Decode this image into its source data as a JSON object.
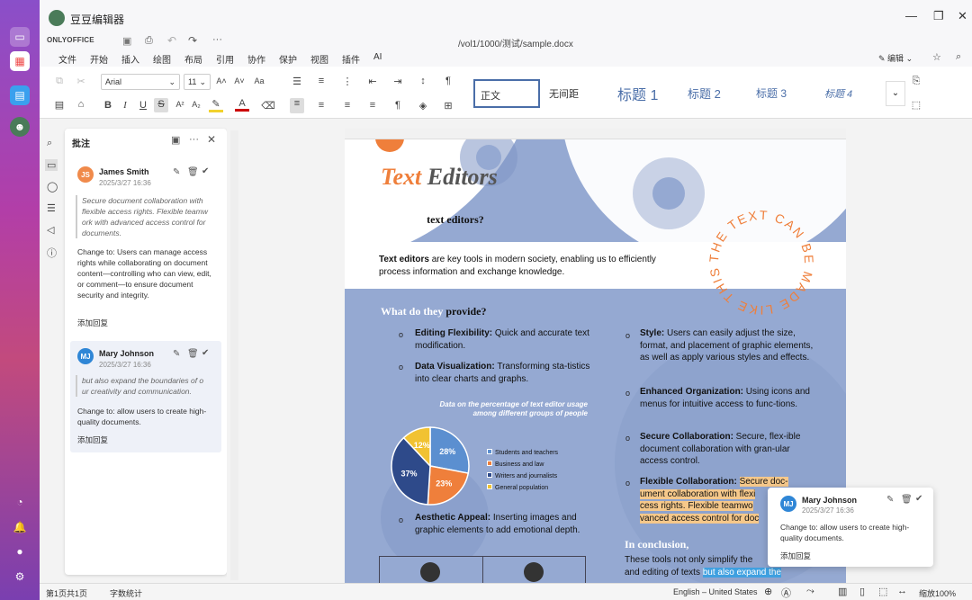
{
  "window": {
    "app_title": "豆豆编辑器"
  },
  "header": {
    "brand": "ONLYOFFICE",
    "doc_path": "/vol1/1000/测试/sample.docx",
    "edit_mode": "编辑"
  },
  "menu": [
    "文件",
    "开始",
    "插入",
    "绘图",
    "布局",
    "引用",
    "协作",
    "保护",
    "视图",
    "插件",
    "AI"
  ],
  "toolbar": {
    "font": "Arial",
    "font_size": "11",
    "styles": [
      "正文",
      "无间距",
      "标题 1",
      "标题 2",
      "标题 3",
      "标题 4"
    ]
  },
  "comments_panel": {
    "title": "批注",
    "items": [
      {
        "initials": "JS",
        "author": "James Smith",
        "date": "2025/3/27 16:36",
        "quote": "Secure document collaboration with flexible access rights. Flexible teamw ork with advanced access control for documents.",
        "text": "Change to: Users can manage access rights while collaborating on document content—controlling who can view, edit, or comment—to ensure document security and integrity.",
        "reply": "添加回复",
        "color": "#f08a4b"
      },
      {
        "initials": "MJ",
        "author": "Mary Johnson",
        "date": "2025/3/27 16:36",
        "quote": "but also expand the boundaries of o ur creativity and communication.",
        "text": "Change to: allow users to create high-quality documents.",
        "reply": "添加回复",
        "color": "#2f86d6"
      }
    ]
  },
  "document": {
    "title_part1": "Text",
    "title_part2": "Editors",
    "what_are": "What are",
    "what_are_bold": "text editors?",
    "intro_bold": "Text editors",
    "intro": " are key tools in modern society, enabling us to efficiently process information and exchange knowledge.",
    "what_do": "What do they",
    "what_do_bold": "provide?",
    "circle_text": "THE TEXT CAN BE MADE LIKE THIS ·",
    "left_items": [
      {
        "h": "Editing Flexibility:",
        "t": " Quick and accurate text modification."
      },
      {
        "h": "Data Visualization:",
        "t": " Transforming sta-tistics into clear charts and graphs."
      }
    ],
    "chart_caption": "Data on the percentage of text editor usage among different groups of people",
    "left_item3": {
      "h": "Aesthetic Appeal:",
      "t": " Inserting images and graphic elements to add emotional depth."
    },
    "right_items": [
      {
        "h": "Style:",
        "t": " Users can easily adjust the size, format, and placement of graphic elements, as well as apply various styles and effects."
      },
      {
        "h": "Enhanced Organization:",
        "t": " Using icons and menus for intuitive access to func-tions."
      },
      {
        "h": "Secure Collaboration:",
        "t": " Secure, flex-ible document collaboration with gran-ular access control."
      }
    ],
    "flex_h": "Flexible Collaboration:",
    "flex_t1": "Secure doc-",
    "flex_t2": "ument collaboration with flexi",
    "flex_t3": "cess rights. Flexible teamwo",
    "flex_t4": "vanced access control for doc",
    "conclusion": "In conclusion,",
    "concl_t1": "These tools not only simplify the",
    "concl_t2": "and editing of texts",
    "concl_hl": "but also expand the"
  },
  "chart_data": {
    "type": "pie",
    "title": "Data on the percentage of text editor usage among different groups of people",
    "categories": [
      "Students and teachers",
      "Business and law",
      "Writers and journalists",
      "General population"
    ],
    "values": [
      28,
      23,
      37,
      12
    ],
    "colors": [
      "#5b8fd0",
      "#ef7f3b",
      "#2e4a8a",
      "#f1c232"
    ]
  },
  "floating_comment": {
    "initials": "MJ",
    "author": "Mary Johnson",
    "date": "2025/3/27 16:36",
    "text": "Change to: allow users to create high-quality documents.",
    "reply": "添加回复"
  },
  "status": {
    "page": "第1页共1页",
    "word_count": "字数统计",
    "language": "English – United States",
    "zoom": "缩放100%"
  }
}
